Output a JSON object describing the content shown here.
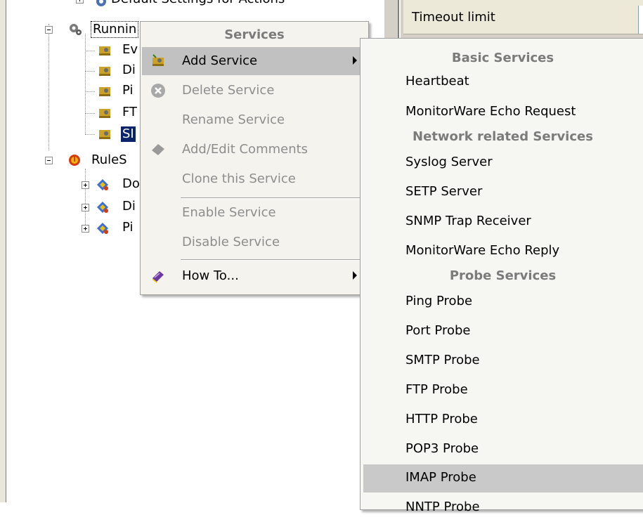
{
  "tree": {
    "top_partial_label": "Default Settings for Actions",
    "running": {
      "label": "Runnin"
    },
    "services": [
      {
        "label": "Ev"
      },
      {
        "label": "Di"
      },
      {
        "label": "Pi"
      },
      {
        "label": "FT"
      },
      {
        "label": "SI",
        "selected": true
      }
    ],
    "rulesets": {
      "label": "RuleS"
    },
    "rules": [
      {
        "label": "Do"
      },
      {
        "label": "Di"
      },
      {
        "label": "Pi"
      }
    ]
  },
  "properties": {
    "timeout_label": "Timeout limit"
  },
  "context_menu": {
    "header": "Services",
    "items": [
      {
        "label": "Add Service",
        "icon": "add-service-icon",
        "submenu": true,
        "disabled": false
      },
      {
        "label": "Delete Service",
        "icon": "delete-icon",
        "disabled": true
      },
      {
        "label": "Rename Service",
        "disabled": true
      },
      {
        "label": "Add/Edit Comments",
        "icon": "comment-icon",
        "disabled": true
      },
      {
        "label": "Clone this Service",
        "disabled": true
      },
      {
        "label": "Enable Service",
        "disabled": true
      },
      {
        "label": "Disable Service",
        "disabled": true
      },
      {
        "label": "How To...",
        "icon": "book-icon",
        "submenu": true,
        "disabled": false
      }
    ]
  },
  "submenu": {
    "headers": {
      "basic": "Basic Services",
      "network": "Network related Services",
      "probe": "Probe Services"
    },
    "basic": [
      "Heartbeat",
      "MonitorWare Echo Request"
    ],
    "network": [
      "Syslog Server",
      "SETP Server",
      "SNMP Trap Receiver",
      "MonitorWare Echo Reply"
    ],
    "probe": [
      "Ping Probe",
      "Port Probe",
      "SMTP Probe",
      "FTP Probe",
      "HTTP Probe",
      "POP3 Probe",
      "IMAP Probe",
      "NNTP Probe"
    ]
  },
  "colors": {
    "selection": "#0a246a",
    "menu_hover": "#c1c1c1",
    "disabled_text": "#8d8d8d",
    "header_text": "#7b7b7b"
  }
}
